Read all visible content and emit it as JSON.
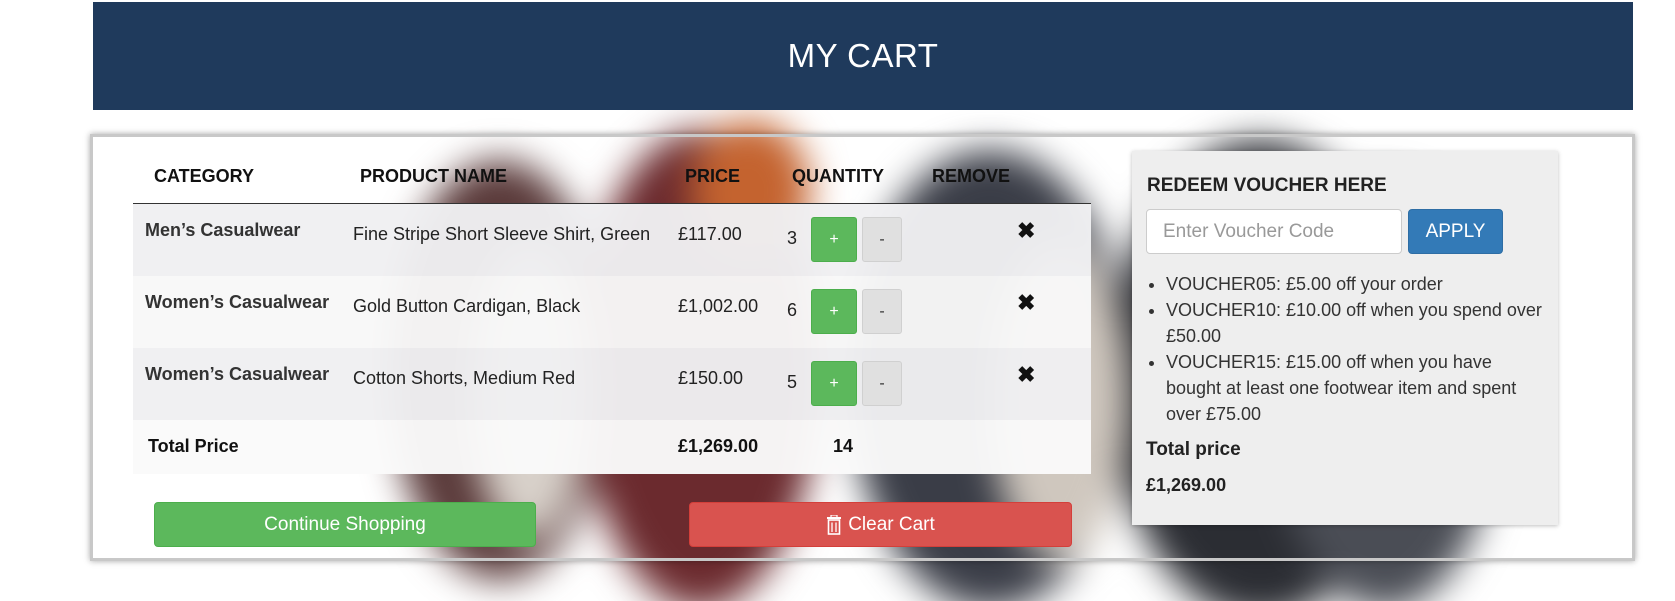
{
  "header": {
    "title": "MY CART"
  },
  "table": {
    "columns": [
      "CATEGORY",
      "PRODUCT NAME",
      "PRICE",
      "QUANTITY",
      "REMOVE"
    ],
    "rows": [
      {
        "category": "Men’s Casualwear",
        "product": "Fine Stripe Short Sleeve Shirt, Green",
        "price": "£117.00",
        "quantity": "3",
        "plus": "+",
        "minus": "-",
        "remove": "✖"
      },
      {
        "category": "Women’s Casualwear",
        "product": "Gold Button Cardigan, Black",
        "price": "£1,002.00",
        "quantity": "6",
        "plus": "+",
        "minus": "-",
        "remove": "✖"
      },
      {
        "category": "Women’s Casualwear",
        "product": "Cotton Shorts, Medium Red",
        "price": "£150.00",
        "quantity": "5",
        "plus": "+",
        "minus": "-",
        "remove": "✖"
      }
    ],
    "total": {
      "label": "Total Price",
      "price": "£1,269.00",
      "quantity": "14"
    }
  },
  "actions": {
    "continue_label": "Continue Shopping",
    "clear_label": "Clear Cart",
    "clear_icon": "trash-icon"
  },
  "voucher": {
    "title": "REDEEM VOUCHER HERE",
    "input_placeholder": "Enter Voucher Code",
    "apply_label": "APPLY",
    "offers": [
      "VOUCHER05: £5.00 off your order",
      "VOUCHER10: £10.00 off when you spend over £50.00",
      "VOUCHER15: £15.00 off when you have bought at least one footwear item and spent over £75.00"
    ],
    "total_label": "Total price",
    "total_value": "£1,269.00"
  },
  "colors": {
    "header_bg": "#1f3a5c",
    "success": "#5cb85c",
    "danger": "#d9534f",
    "primary": "#337ab7"
  }
}
